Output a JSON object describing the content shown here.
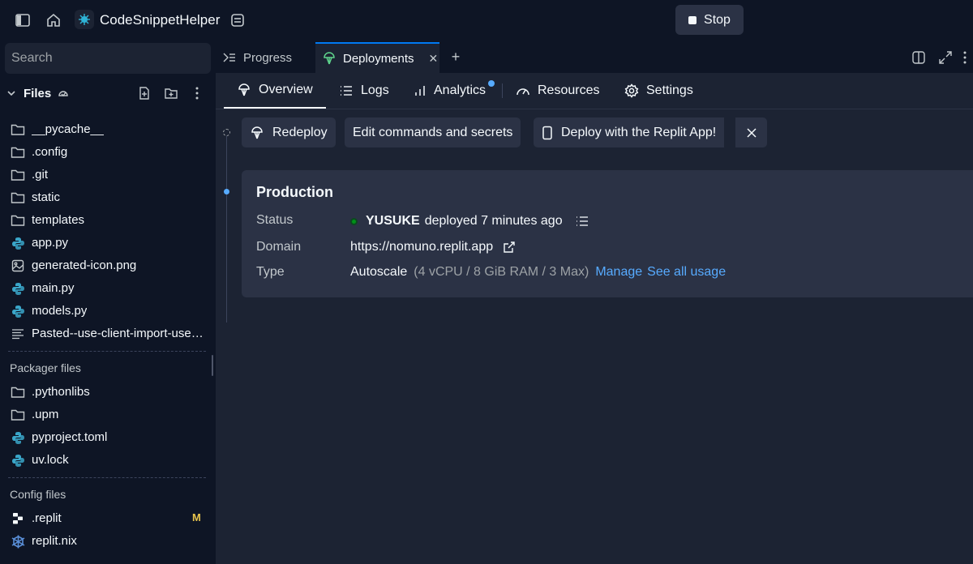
{
  "topbar": {
    "app_title": "CodeSnippetHelper",
    "stop_label": "Stop"
  },
  "sidebar": {
    "search_placeholder": "Search",
    "files_label": "Files",
    "files": [
      {
        "name": "__pycache__",
        "icon": "folder-icon"
      },
      {
        "name": ".config",
        "icon": "folder-icon"
      },
      {
        "name": ".git",
        "icon": "folder-icon"
      },
      {
        "name": "static",
        "icon": "folder-icon"
      },
      {
        "name": "templates",
        "icon": "folder-icon"
      },
      {
        "name": "app.py",
        "icon": "python-icon"
      },
      {
        "name": "generated-icon.png",
        "icon": "image-icon"
      },
      {
        "name": "main.py",
        "icon": "python-icon"
      },
      {
        "name": "models.py",
        "icon": "python-icon"
      },
      {
        "name": "Pasted--use-client-import-use-Stat",
        "icon": "text-file-icon"
      }
    ],
    "packager_label": "Packager files",
    "packager_files": [
      {
        "name": ".pythonlibs",
        "icon": "folder-icon"
      },
      {
        "name": ".upm",
        "icon": "folder-icon"
      },
      {
        "name": "pyproject.toml",
        "icon": "python-icon"
      },
      {
        "name": "uv.lock",
        "icon": "python-icon"
      }
    ],
    "config_label": "Config files",
    "config_files": [
      {
        "name": ".replit",
        "icon": "replit-icon",
        "badge": "M"
      },
      {
        "name": "replit.nix",
        "icon": "nix-icon"
      }
    ]
  },
  "tabs": {
    "progress": "Progress",
    "deployments": "Deployments"
  },
  "subnav": {
    "overview": "Overview",
    "logs": "Logs",
    "analytics": "Analytics",
    "resources": "Resources",
    "settings": "Settings"
  },
  "actions": {
    "redeploy": "Redeploy",
    "edit": "Edit commands and secrets",
    "deploy_app": "Deploy with the Replit App!"
  },
  "production": {
    "title": "Production",
    "status_label": "Status",
    "status_user": "YUSUKE",
    "status_text": "deployed 7 minutes ago",
    "domain_label": "Domain",
    "domain": "https://nomuno.replit.app",
    "type_label": "Type",
    "type_value": "Autoscale",
    "type_detail": "(4 vCPU / 8 GiB RAM / 3 Max)",
    "manage": "Manage",
    "see_usage": "See all usage"
  },
  "colors": {
    "accent": "#57abff",
    "status_green": "#009118",
    "modified": "#e8c44d"
  }
}
